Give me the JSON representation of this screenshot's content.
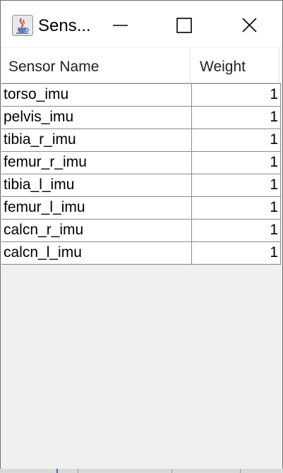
{
  "window": {
    "title": "Sens...",
    "app_icon": "java-cup-icon",
    "buttons": {
      "minimize": "minimize-icon",
      "maximize": "maximize-icon",
      "close": "close-icon"
    }
  },
  "table": {
    "columns": [
      "Sensor Name",
      "Weight"
    ],
    "rows": [
      {
        "name": "torso_imu",
        "weight": "1"
      },
      {
        "name": "pelvis_imu",
        "weight": "1"
      },
      {
        "name": "tibia_r_imu",
        "weight": "1"
      },
      {
        "name": "femur_r_imu",
        "weight": "1"
      },
      {
        "name": "tibia_l_imu",
        "weight": "1"
      },
      {
        "name": "femur_l_imu",
        "weight": "1"
      },
      {
        "name": "calcn_r_imu",
        "weight": "1"
      },
      {
        "name": "calcn_l_imu",
        "weight": "1"
      }
    ]
  }
}
